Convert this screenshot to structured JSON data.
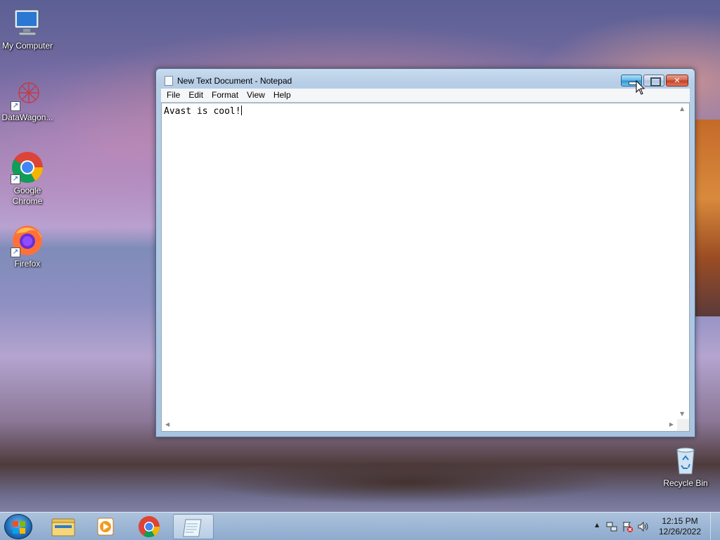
{
  "desktop": {
    "icons": [
      {
        "label": "My Computer",
        "icon": "computer-icon"
      },
      {
        "label": "DataWagon...",
        "icon": "datawagon-icon"
      },
      {
        "label": "Google Chrome",
        "icon": "chrome-icon"
      },
      {
        "label": "Firefox",
        "icon": "firefox-icon"
      },
      {
        "label": "Recycle Bin",
        "icon": "recycle-bin-icon"
      }
    ]
  },
  "window": {
    "title": "New Text Document - Notepad",
    "menu": [
      "File",
      "Edit",
      "Format",
      "View",
      "Help"
    ],
    "content": "Avast is cool!",
    "caption_buttons": [
      "minimize",
      "maximize",
      "close"
    ]
  },
  "taskbar": {
    "pinned": [
      {
        "name": "start-button",
        "icon": "windows-logo-icon"
      },
      {
        "name": "explorer",
        "icon": "folder-icon"
      },
      {
        "name": "media-player",
        "icon": "media-player-icon"
      },
      {
        "name": "chrome",
        "icon": "chrome-icon"
      },
      {
        "name": "notepad",
        "icon": "notepad-icon",
        "active": true
      }
    ],
    "tray_icons": [
      "show-hidden-icons-arrow",
      "network-icon",
      "action-center-icon",
      "volume-icon"
    ],
    "clock": {
      "time": "12:15 PM",
      "date": "12/26/2022"
    }
  },
  "colors": {
    "window_frame": "#a9c3e0",
    "close_button": "#c13b1f",
    "minimize_hover": "#2d8fce",
    "taskbar": "#8caacd"
  }
}
